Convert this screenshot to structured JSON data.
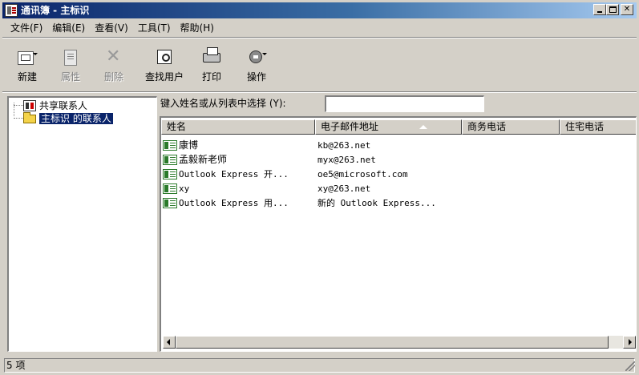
{
  "window": {
    "title": "通讯簿 - 主标识"
  },
  "menu": [
    "文件(F)",
    "编辑(E)",
    "查看(V)",
    "工具(T)",
    "帮助(H)"
  ],
  "toolbar": {
    "new_label": "新建",
    "properties_label": "属性",
    "delete_label": "删除",
    "find_label": "查找用户",
    "print_label": "打印",
    "action_label": "操作"
  },
  "folders": [
    "共享联系人",
    "主标识 的联系人"
  ],
  "search": {
    "label": "键入姓名或从列表中选择 (Y):",
    "value": ""
  },
  "columns": [
    "姓名",
    "电子邮件地址",
    "商务电话",
    "住宅电话"
  ],
  "contacts": [
    {
      "name": "康博",
      "email": "kb@263.net"
    },
    {
      "name": "孟毅新老师",
      "email": "myx@263.net"
    },
    {
      "name": "Outlook Express 开...",
      "email": "oe5@microsoft.com"
    },
    {
      "name": "xy",
      "email": "xy@263.net"
    },
    {
      "name": "Outlook Express 用...",
      "email": "新的 Outlook Express..."
    }
  ],
  "status": {
    "text": "5 项"
  }
}
